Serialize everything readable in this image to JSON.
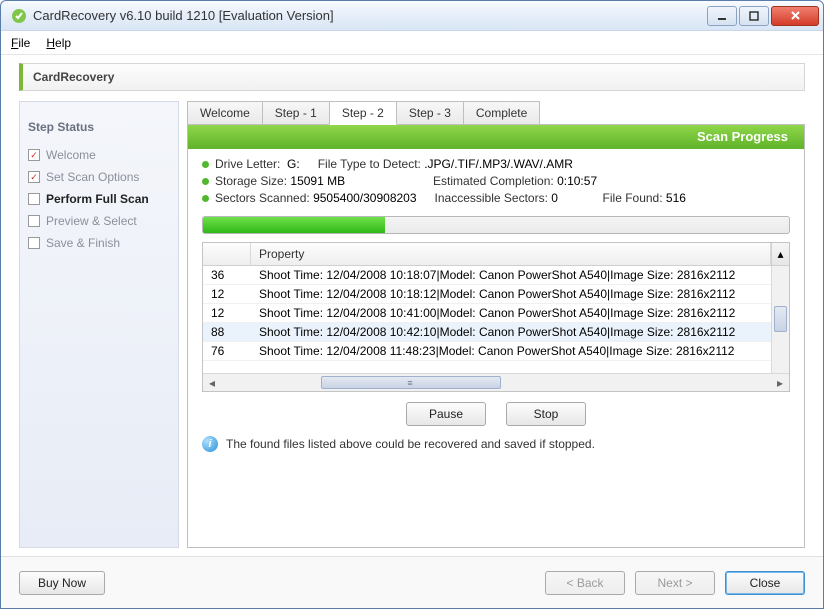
{
  "window": {
    "title": "CardRecovery v6.10 build 1210 [Evaluation Version]"
  },
  "menu": {
    "file": "File",
    "help": "Help"
  },
  "header": {
    "app_name": "CardRecovery"
  },
  "sidebar": {
    "heading": "Step Status",
    "items": [
      {
        "label": "Welcome",
        "done": true,
        "active": false
      },
      {
        "label": "Set Scan Options",
        "done": true,
        "active": false
      },
      {
        "label": "Perform Full Scan",
        "done": false,
        "active": true
      },
      {
        "label": "Preview & Select",
        "done": false,
        "active": false
      },
      {
        "label": "Save & Finish",
        "done": false,
        "active": false
      }
    ]
  },
  "tabs": [
    {
      "label": "Welcome",
      "active": false
    },
    {
      "label": "Step - 1",
      "active": false
    },
    {
      "label": "Step - 2",
      "active": true
    },
    {
      "label": "Step - 3",
      "active": false
    },
    {
      "label": "Complete",
      "active": false
    }
  ],
  "scan_panel": {
    "title": "Scan Progress",
    "drive_letter_label": "Drive Letter:",
    "drive_letter_value": "G:",
    "file_type_label": "File Type to Detect:",
    "file_type_value": ".JPG/.TIF/.MP3/.WAV/.AMR",
    "storage_size_label": "Storage Size:",
    "storage_size_value": "15091 MB",
    "estimated_label": "Estimated Completion:",
    "estimated_value": "0:10:57",
    "sectors_label": "Sectors Scanned:",
    "sectors_value": "9505400/30908203",
    "inaccessible_label": "Inaccessible Sectors:",
    "inaccessible_value": "0",
    "filefound_label": "File Found:",
    "filefound_value": "516",
    "progress_percent": 31
  },
  "grid": {
    "col1": "",
    "col2": "Property",
    "rows": [
      {
        "n": "36",
        "prop": "Shoot Time: 12/04/2008 10:18:07|Model: Canon PowerShot A540|Image Size: 2816x2112"
      },
      {
        "n": "12",
        "prop": "Shoot Time: 12/04/2008 10:18:12|Model: Canon PowerShot A540|Image Size: 2816x2112"
      },
      {
        "n": "12",
        "prop": "Shoot Time: 12/04/2008 10:41:00|Model: Canon PowerShot A540|Image Size: 2816x2112"
      },
      {
        "n": "88",
        "prop": "Shoot Time: 12/04/2008 10:42:10|Model: Canon PowerShot A540|Image Size: 2816x2112"
      },
      {
        "n": "76",
        "prop": "Shoot Time: 12/04/2008 11:48:23|Model: Canon PowerShot A540|Image Size: 2816x2112"
      }
    ]
  },
  "buttons": {
    "pause": "Pause",
    "stop": "Stop"
  },
  "info_text": "The found files listed above could be recovered and saved if stopped.",
  "footer": {
    "buy": "Buy Now",
    "back": "< Back",
    "next": "Next >",
    "close": "Close"
  }
}
